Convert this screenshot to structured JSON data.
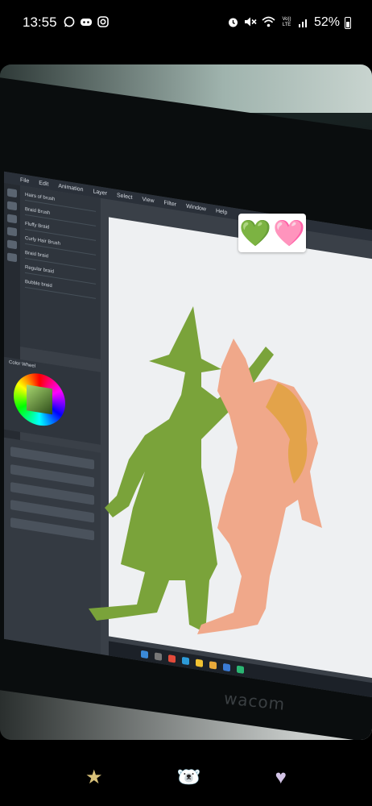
{
  "status_bar": {
    "time": "13:55",
    "left_icons": [
      "whatsapp-icon",
      "discord-icon",
      "instagram-icon"
    ],
    "right_icons": [
      "alarm-icon",
      "mute-icon",
      "wifi-icon",
      "volte-icon",
      "signal-icon"
    ],
    "volte_text": "Vo)) LTE",
    "battery_percent": "52%",
    "battery_level": 0.52
  },
  "screen": {
    "menu": [
      "File",
      "Edit",
      "Animation",
      "Layer",
      "Select",
      "View",
      "Filter",
      "Window",
      "Help"
    ],
    "brushes": [
      "Hairs of brush",
      "Braid Brush",
      "Fluffy Braid",
      "Curly Hair Brush",
      "Braid braid",
      "Regular braid",
      "Bubble braid"
    ],
    "color_panel_title": "Color Wheel",
    "monitor_brand": "wacom"
  },
  "sticker": {
    "hearts": [
      "💚",
      "🩷"
    ]
  },
  "reactions": [
    {
      "name": "star",
      "glyph": "★",
      "color": "#d9c27a"
    },
    {
      "name": "bear",
      "glyph": "🐻‍❄️",
      "color": "#e8e4ec"
    },
    {
      "name": "heart",
      "glyph": "♥",
      "color": "#d3c4e6"
    }
  ],
  "colors": {
    "witch_silhouette": "#7aa33a",
    "girl_silhouette": "#f0a88a",
    "girl_hair_accent": "#e3a34a"
  }
}
